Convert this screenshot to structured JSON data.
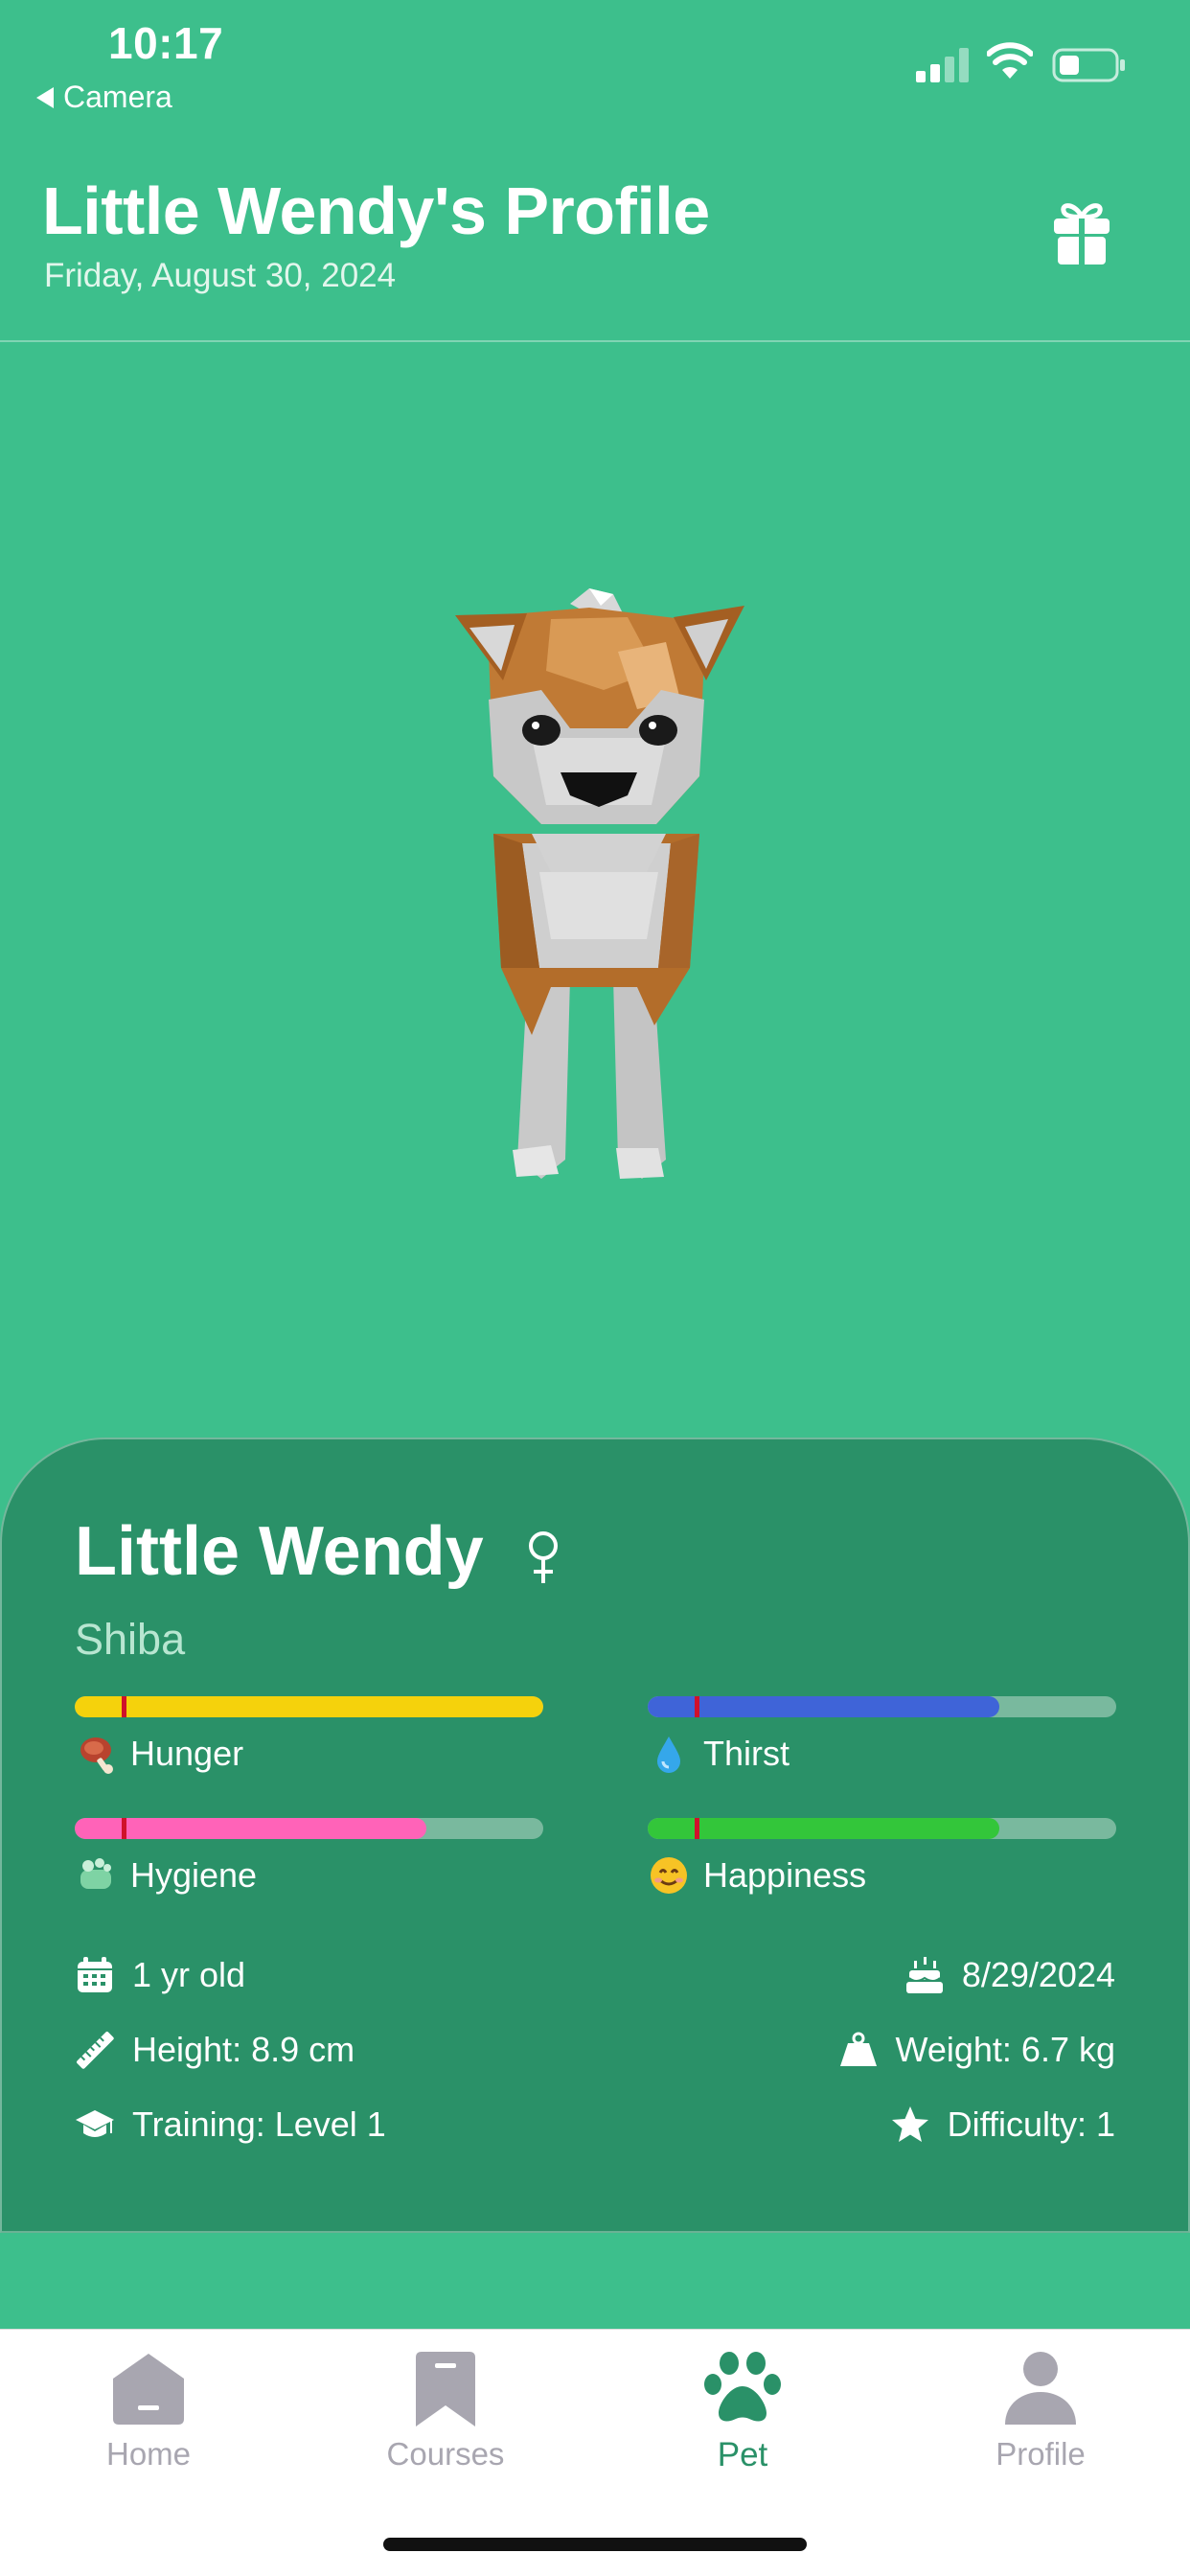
{
  "status_bar": {
    "time": "10:17",
    "back_label": "Camera"
  },
  "header": {
    "title": "Little Wendy's Profile",
    "date": "Friday, August 30, 2024",
    "gift_icon": "gift-icon"
  },
  "pet": {
    "name": "Little Wendy",
    "gender_icon": "female-symbol-icon",
    "breed": "Shiba",
    "stats": [
      {
        "label": "Hunger",
        "icon": "meat-icon",
        "value": 1.0,
        "marker": 0.1,
        "color": "#f5d20c"
      },
      {
        "label": "Thirst",
        "icon": "droplet-icon",
        "value": 0.75,
        "marker": 0.1,
        "color": "#3f64d8"
      },
      {
        "label": "Hygiene",
        "icon": "soap-icon",
        "value": 0.75,
        "marker": 0.1,
        "color": "#ff63b8"
      },
      {
        "label": "Happiness",
        "icon": "smiley-icon",
        "value": 0.75,
        "marker": 0.1,
        "color": "#33c63a"
      }
    ],
    "info": {
      "age": "1 yr old",
      "birthday": "8/29/2024",
      "height": "Height: 8.9 cm",
      "weight": "Weight: 6.7 kg",
      "training": "Training: Level 1",
      "difficulty": "Difficulty: 1"
    }
  },
  "tabbar": {
    "tabs": [
      {
        "label": "Home",
        "icon": "home-icon",
        "active": false
      },
      {
        "label": "Courses",
        "icon": "bookmark-icon",
        "active": false
      },
      {
        "label": "Pet",
        "icon": "paw-icon",
        "active": true
      },
      {
        "label": "Profile",
        "icon": "person-icon",
        "active": false
      }
    ]
  },
  "colors": {
    "background": "#3dbf8c",
    "card": "#2a9168",
    "accent": "#2a9168",
    "inactive_tab": "#a8a6b0",
    "marker": "#d0112b"
  }
}
